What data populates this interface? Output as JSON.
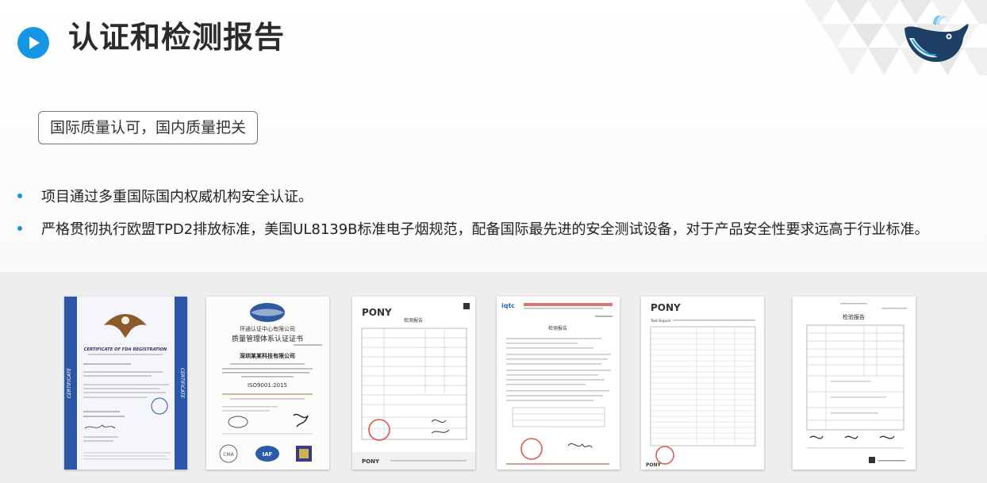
{
  "header": {
    "title": "认证和检测报告",
    "play_icon": "play-icon",
    "logo_icon": "whale-logo-icon",
    "accent": "#1496e4"
  },
  "tag": {
    "label": "国际质量认可，国内质量把关"
  },
  "bullets": [
    "项目通过多重国际国内权威机构安全认证。",
    "严格贯彻执行欧盟TPD2排放标准，美国UL8139B标准电子烟规范，配备国际最先进的安全测试设备，对于产品安全性要求远高于行业标准。"
  ],
  "certificates": {
    "fda": {
      "heading": "CERTIFICATE OF FDA REGISTRATION",
      "side": "CERTIFICATE"
    },
    "iso": {
      "org": "环通认证中心有限公司",
      "heading": "质量管理体系认证证书",
      "company": "深圳某某科技有限公司",
      "standard": "ISO9001:2015"
    },
    "pony1": {
      "brand": "PONY",
      "heading": "检测报告"
    },
    "cqtc": {
      "brand": "iqtc",
      "heading": "检测报告"
    },
    "pony2": {
      "brand": "PONY",
      "heading": "Test Report"
    },
    "report": {
      "heading": "检验报告"
    }
  }
}
